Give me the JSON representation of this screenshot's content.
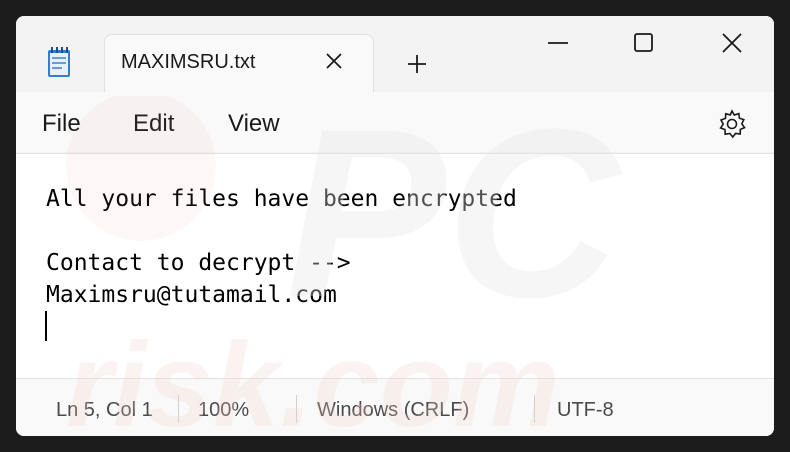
{
  "window": {
    "tab_title": "MAXIMSRU.txt",
    "icons": {
      "app": "notepad-icon",
      "tab_close": "close-icon",
      "new_tab": "plus-icon",
      "minimize": "minimize-icon",
      "maximize": "maximize-icon",
      "close": "close-icon",
      "settings": "gear-icon"
    }
  },
  "menu": {
    "file": "File",
    "edit": "Edit",
    "view": "View"
  },
  "editor": {
    "lines": [
      "All your files have been encrypted",
      "",
      "Contact to decrypt -->",
      "Maximsru@tutamail.com",
      ""
    ]
  },
  "status": {
    "position": "Ln 5, Col 1",
    "zoom": "100%",
    "line_ending": "Windows (CRLF)",
    "encoding": "UTF-8"
  },
  "watermark": {
    "top": "PC",
    "bottom": "risk.com"
  },
  "colors": {
    "background": "#1c1c1c",
    "window": "#f3f3f3",
    "editor": "#ffffff"
  }
}
